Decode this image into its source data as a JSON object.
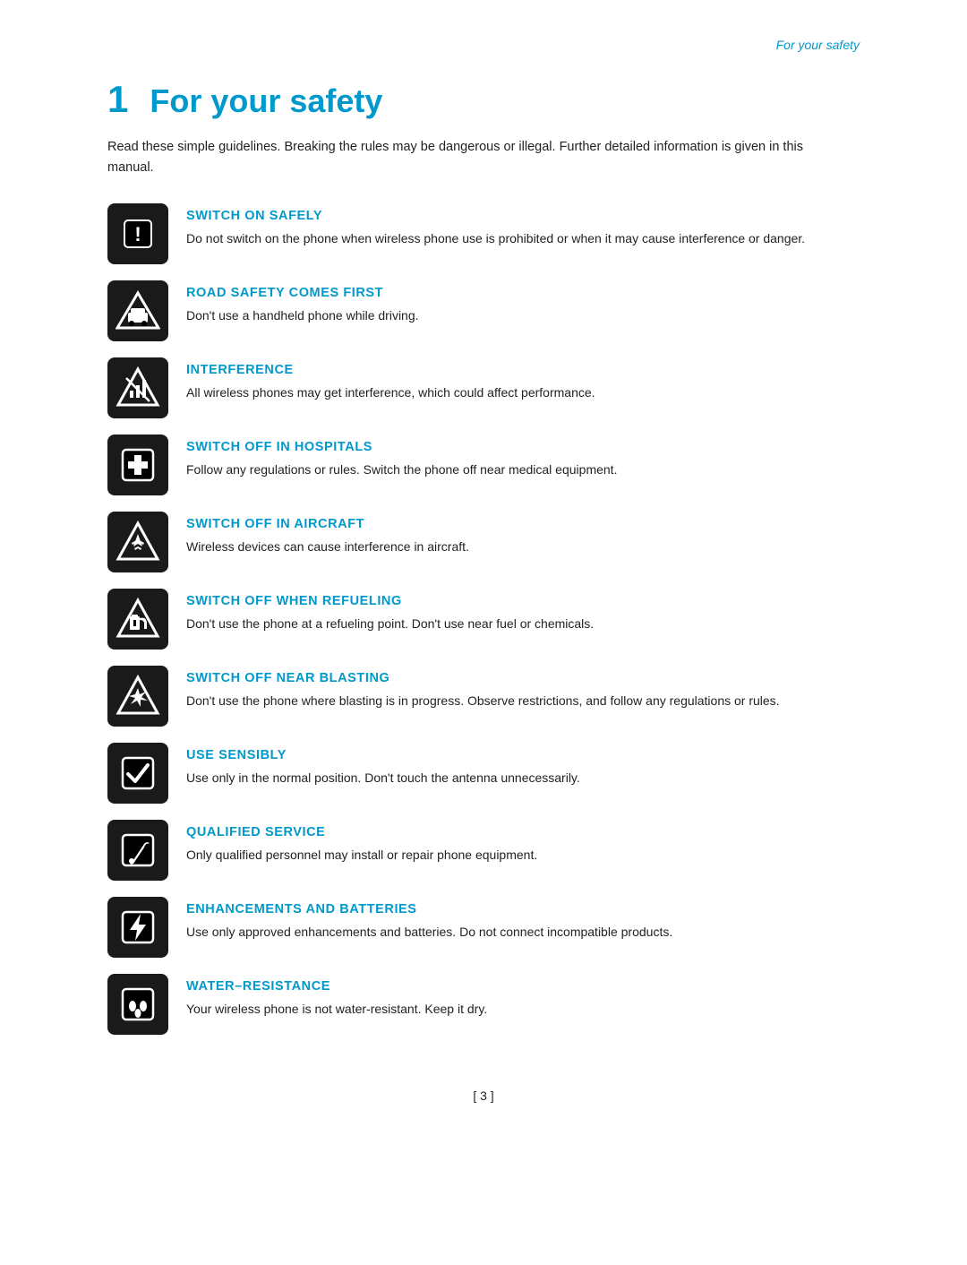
{
  "header": {
    "label": "For your safety"
  },
  "chapter": {
    "number": "1",
    "title": "For your safety"
  },
  "intro": "Read these simple guidelines. Breaking the rules may be dangerous or illegal. Further detailed information is given in this manual.",
  "items": [
    {
      "id": "switch-on-safely",
      "title": "SWITCH ON SAFELY",
      "description": "Do not switch on the phone when wireless phone use is prohibited or when it may cause interference or danger.",
      "icon": "exclamation"
    },
    {
      "id": "road-safety",
      "title": "ROAD SAFETY COMES FIRST",
      "description": "Don't use a handheld phone while driving.",
      "icon": "car"
    },
    {
      "id": "interference",
      "title": "INTERFERENCE",
      "description": "All wireless phones may get interference, which could affect performance.",
      "icon": "signal"
    },
    {
      "id": "switch-off-hospitals",
      "title": "SWITCH OFF IN HOSPITALS",
      "description": "Follow any regulations or rules. Switch the phone off near medical equipment.",
      "icon": "cross"
    },
    {
      "id": "switch-off-aircraft",
      "title": "SWITCH OFF IN AIRCRAFT",
      "description": "Wireless devices can cause interference in aircraft.",
      "icon": "aircraft"
    },
    {
      "id": "switch-off-refueling",
      "title": "SWITCH OFF WHEN REFUELING",
      "description": "Don't use the phone at a refueling point. Don't use near fuel or chemicals.",
      "icon": "fuel"
    },
    {
      "id": "switch-off-blasting",
      "title": "SWITCH OFF NEAR BLASTING",
      "description": "Don't use the phone where blasting is in progress. Observe restrictions, and follow any regulations or rules.",
      "icon": "blast"
    },
    {
      "id": "use-sensibly",
      "title": "USE SENSIBLY",
      "description": "Use only in the normal position. Don't touch the antenna unnecessarily.",
      "icon": "checkmark"
    },
    {
      "id": "qualified-service",
      "title": "QUALIFIED SERVICE",
      "description": "Only qualified personnel may install or repair phone equipment.",
      "icon": "wrench"
    },
    {
      "id": "enhancements-batteries",
      "title": "ENHANCEMENTS AND BATTERIES",
      "description": "Use only approved enhancements and batteries. Do not connect incompatible products.",
      "icon": "lightning"
    },
    {
      "id": "water-resistance",
      "title": "WATER–RESISTANCE",
      "description": "Your wireless phone is not water-resistant. Keep it dry.",
      "icon": "drops"
    }
  ],
  "page_number": "[ 3 ]"
}
